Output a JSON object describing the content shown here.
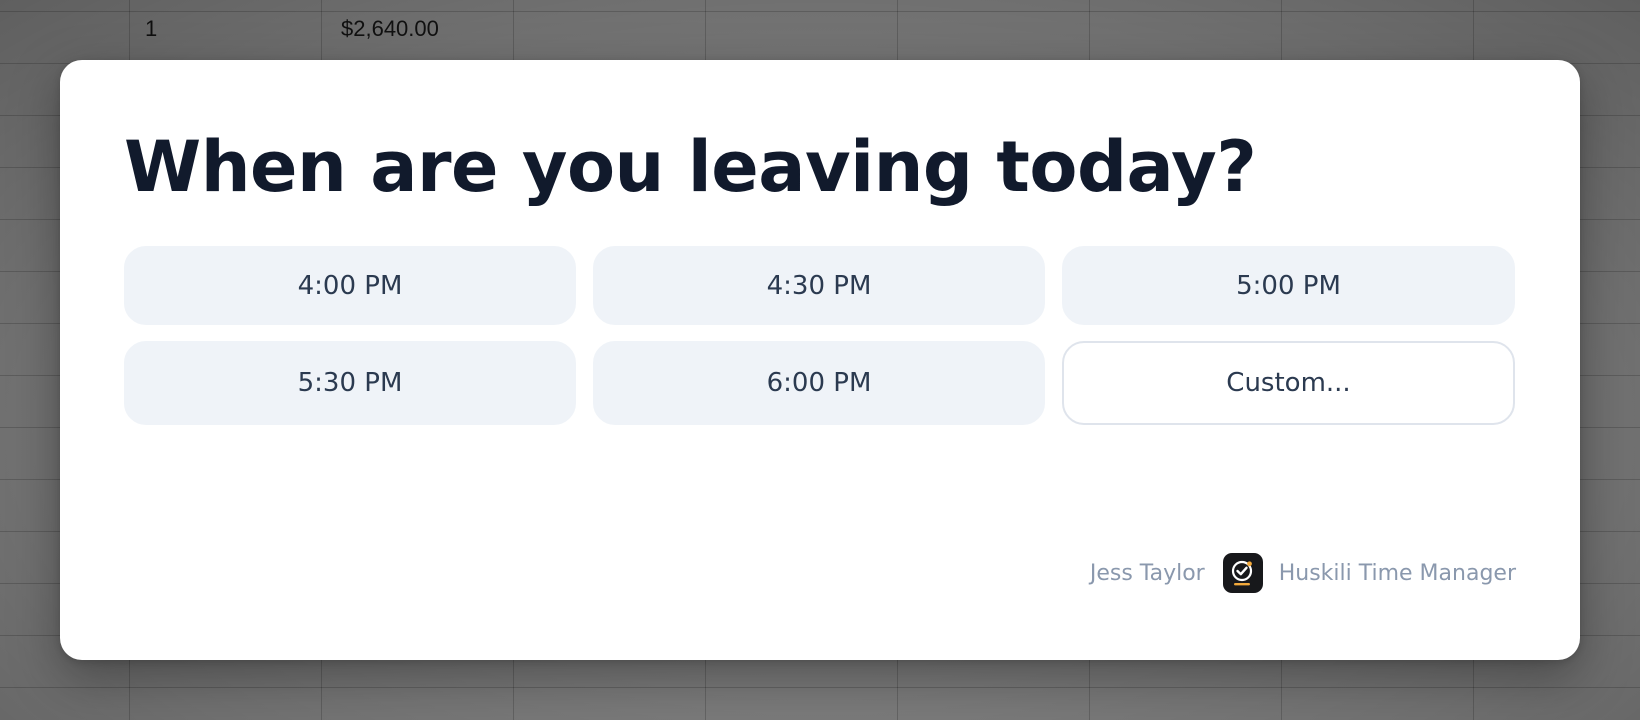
{
  "spreadsheet": {
    "row1": {
      "cell_a": "1",
      "cell_b": "$2,640.00"
    }
  },
  "dialog": {
    "title": "When are you leaving today?",
    "options": [
      {
        "label": "4:00 PM"
      },
      {
        "label": "4:30 PM"
      },
      {
        "label": "5:00 PM"
      },
      {
        "label": "5:30 PM"
      },
      {
        "label": "6:00 PM"
      },
      {
        "label": "Custom..."
      }
    ],
    "footer": {
      "user_name": "Jess Taylor",
      "app_icon": "check-clock-icon",
      "app_name": "Huskili Time Manager"
    }
  },
  "colors": {
    "title": "#111a2c",
    "option_bg": "#eff3f8",
    "option_text": "#2b3a50",
    "footer_text": "#8a98ad",
    "app_icon_bg": "#17181b",
    "app_icon_accent": "#f2a93b"
  }
}
